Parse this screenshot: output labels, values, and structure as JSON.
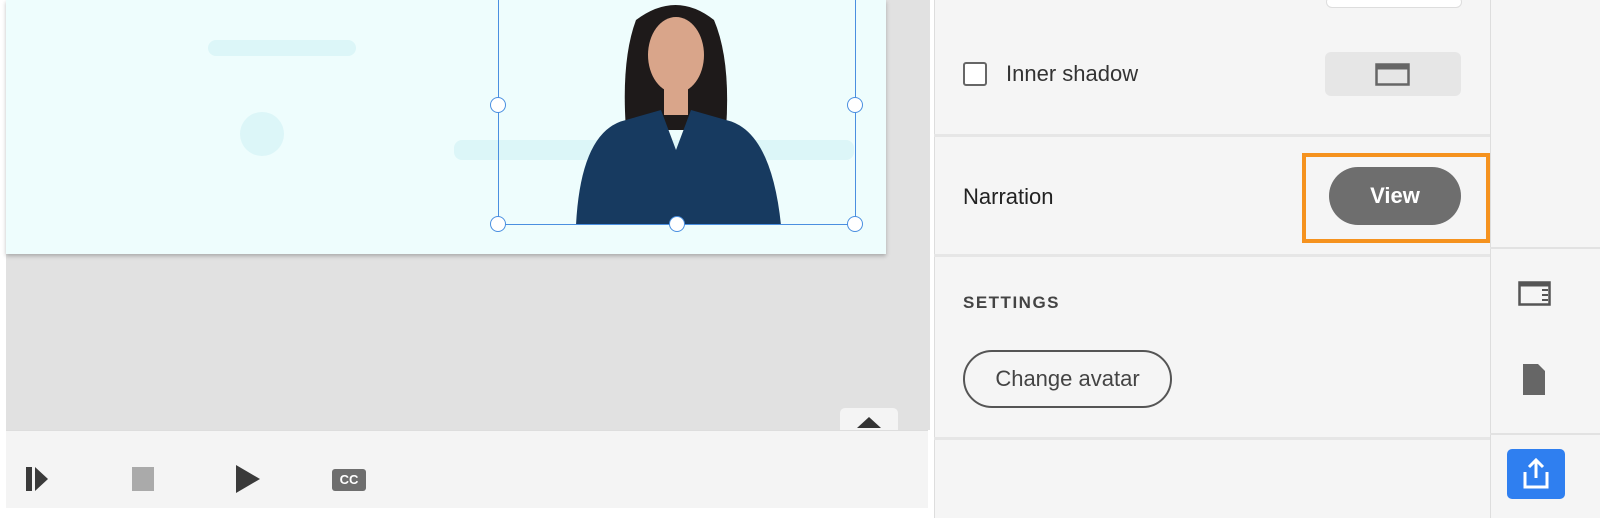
{
  "panel": {
    "inner_shadow_label": "Inner shadow",
    "narration_label": "Narration",
    "view_button": "View",
    "settings_heading": "SETTINGS",
    "change_avatar_button": "Change avatar"
  },
  "player": {
    "cc_label": "CC"
  },
  "colors": {
    "accent": "#2f7ff0",
    "highlight": "#f5921e",
    "selection": "#4a8fe0"
  }
}
